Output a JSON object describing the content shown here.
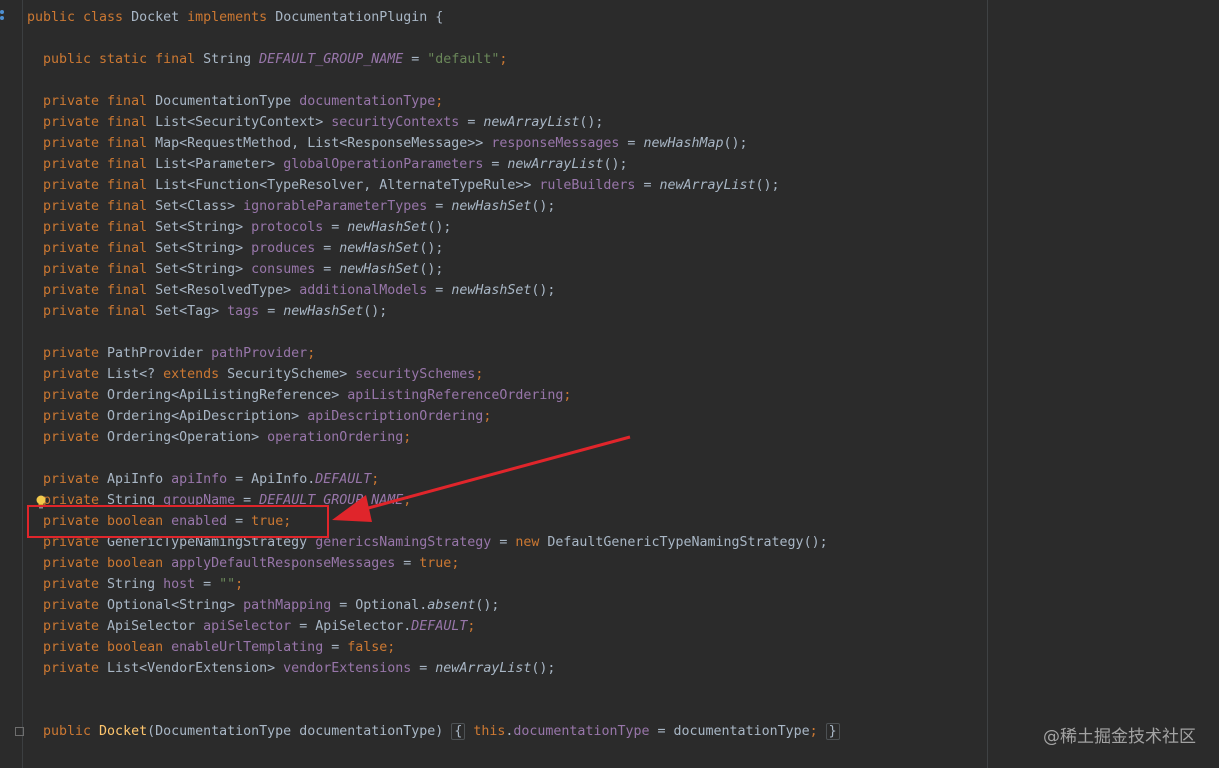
{
  "code": {
    "class_decl": {
      "kw1": "public class ",
      "name": "Docket ",
      "kw2": "implements ",
      "iface": "DocumentationPlugin {"
    },
    "const_line": {
      "kw": "public static final ",
      "type": "String ",
      "name": "DEFAULT_GROUP_NAME",
      "eq": " = ",
      "value": "\"default\"",
      "semi": ";"
    },
    "final_fields": [
      {
        "type": "DocumentationType ",
        "name": "documentationType",
        "init": "",
        "call": "",
        "tail": ";"
      },
      {
        "type": "List<SecurityContext> ",
        "name": "securityContexts",
        "init": " = ",
        "call": "newArrayList",
        "tail": "();"
      },
      {
        "type": "Map<RequestMethod, List<ResponseMessage>> ",
        "name": "responseMessages",
        "init": " = ",
        "call": "newHashMap",
        "tail": "();"
      },
      {
        "type": "List<Parameter> ",
        "name": "globalOperationParameters",
        "init": " = ",
        "call": "newArrayList",
        "tail": "();"
      },
      {
        "type": "List<Function<TypeResolver, AlternateTypeRule>> ",
        "name": "ruleBuilders",
        "init": " = ",
        "call": "newArrayList",
        "tail": "();"
      },
      {
        "type": "Set<Class> ",
        "name": "ignorableParameterTypes",
        "init": " = ",
        "call": "newHashSet",
        "tail": "();"
      },
      {
        "type": "Set<String> ",
        "name": "protocols",
        "init": " = ",
        "call": "newHashSet",
        "tail": "();"
      },
      {
        "type": "Set<String> ",
        "name": "produces",
        "init": " = ",
        "call": "newHashSet",
        "tail": "();"
      },
      {
        "type": "Set<String> ",
        "name": "consumes",
        "init": " = ",
        "call": "newHashSet",
        "tail": "();"
      },
      {
        "type": "Set<ResolvedType> ",
        "name": "additionalModels",
        "init": " = ",
        "call": "newHashSet",
        "tail": "();"
      },
      {
        "type": "Set<Tag> ",
        "name": "tags",
        "init": " = ",
        "call": "newHashSet",
        "tail": "();"
      }
    ],
    "private_kw": "private ",
    "final_kw": "final ",
    "path_provider": {
      "type": "PathProvider ",
      "name": "pathProvider",
      "tail": ";"
    },
    "security_schemes": {
      "t1": "List<? ",
      "ext": "extends ",
      "t2": "SecurityScheme> ",
      "name": "securitySchemes",
      "tail": ";"
    },
    "ordering_fields": [
      {
        "type": "Ordering<ApiListingReference> ",
        "name": "apiListingReferenceOrdering",
        "tail": ";"
      },
      {
        "type": "Ordering<ApiDescription> ",
        "name": "apiDescriptionOrdering",
        "tail": ";"
      },
      {
        "type": "Ordering<Operation> ",
        "name": "operationOrdering",
        "tail": ";"
      }
    ],
    "api_info": {
      "type": "ApiInfo ",
      "name": "apiInfo",
      "eq": " = ",
      "cls": "ApiInfo.",
      "const": "DEFAULT",
      "tail": ";"
    },
    "group_name": {
      "type": "String ",
      "name": "groupName",
      "eq": " = ",
      "const": "DEFAULT_GROUP_NAME",
      "tail": ";"
    },
    "enabled": {
      "type": "boolean ",
      "name": "enabled",
      "eq": " = ",
      "val": "true",
      "tail": ";"
    },
    "generics": {
      "type": "GenericTypeNamingStrategy ",
      "name": "genericsNamingStrategy",
      "eq": " = ",
      "new": "new ",
      "cls": "DefaultGenericTypeNamingStrategy",
      "tail": "();"
    },
    "apply_default": {
      "type": "boolean ",
      "name": "applyDefaultResponseMessages",
      "eq": " = ",
      "val": "true",
      "tail": ";"
    },
    "host": {
      "type": "String ",
      "name": "host",
      "eq": " = ",
      "val": "\"\"",
      "tail": ";"
    },
    "path_mapping": {
      "type": "Optional<String> ",
      "name": "pathMapping",
      "eq": " = ",
      "cls": "Optional.",
      "call": "absent",
      "tail": "();"
    },
    "api_selector": {
      "type": "ApiSelector ",
      "name": "apiSelector",
      "eq": " = ",
      "cls": "ApiSelector.",
      "const": "DEFAULT",
      "tail": ";"
    },
    "url_templating": {
      "type": "boolean ",
      "name": "enableUrlTemplating",
      "eq": " = ",
      "val": "false",
      "tail": ";"
    },
    "vendor_ext": {
      "type": "List<VendorExtension> ",
      "name": "vendorExtensions",
      "eq": " = ",
      "call": "newArrayList",
      "tail": "();"
    },
    "constructor": {
      "kw": "public ",
      "name": "Docket",
      "params": "(DocumentationType documentationType)",
      "open": "{",
      "this": "this",
      "dot": ".",
      "field": "documentationType",
      "eq": " = ",
      "rhs": "documentationType",
      "semi": ";",
      "close": "}"
    }
  },
  "watermark": "@稀土掘金技术社区",
  "colors": {
    "background": "#2b2b2b",
    "keyword": "#cc7832",
    "field": "#9876aa",
    "string": "#6a8759",
    "text": "#a9b7c6",
    "method": "#ffc66d",
    "annotation_red": "#e0252b"
  }
}
